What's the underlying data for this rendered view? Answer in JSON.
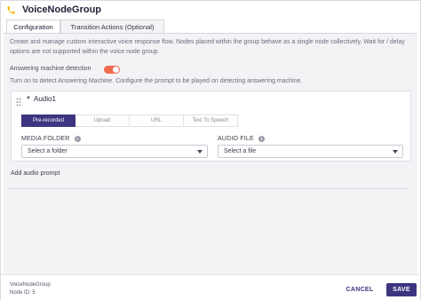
{
  "header": {
    "title": "VoiceNodeGroup",
    "icon": "phone-icon",
    "icon_color": "#f5b800"
  },
  "tabs": [
    {
      "label": "Configuration",
      "active": true
    },
    {
      "label": "Transition Actions (Optional)",
      "active": false
    }
  ],
  "description": "Create and manage custom interactive voice response flow. Nodes placed within the group behave as a single node collectively. Wait for / delay options are not supported within the voice node group.",
  "amd": {
    "label": "Answering machine detection",
    "enabled": true,
    "help": "Turn on to detect Answering Machine. Configure the prompt to be played on detecting answering machine.",
    "toggle_color": "#f06b4f"
  },
  "audio": {
    "title": "Audio1",
    "source_tabs": [
      {
        "label": "Pre-recorded",
        "active": true
      },
      {
        "label": "Upload",
        "active": false
      },
      {
        "label": "URL",
        "active": false
      },
      {
        "label": "Text To Speech",
        "active": false
      }
    ],
    "media_folder": {
      "label": "MEDIA FOLDER",
      "value": "Select a folder"
    },
    "audio_file": {
      "label": "AUDIO FILE",
      "value": "Select a file"
    }
  },
  "add_audio_label": "Add audio prompt",
  "footer": {
    "node_name": "VoiceNodeGroup",
    "node_id": "Node ID: 5",
    "cancel_label": "CANCEL",
    "save_label": "SAVE",
    "accent": "#3d3580"
  }
}
